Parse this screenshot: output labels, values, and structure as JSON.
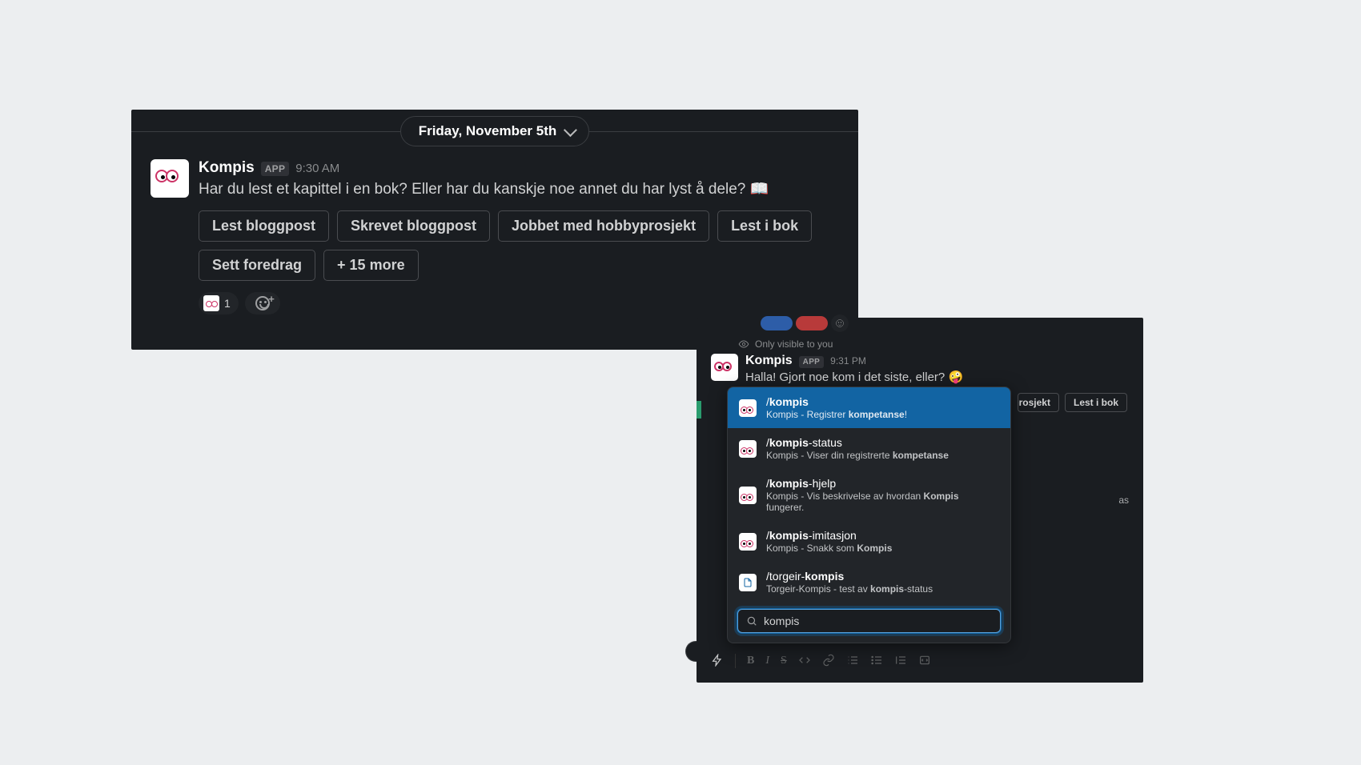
{
  "panel1": {
    "date": "Friday, November 5th",
    "sender": "Kompis",
    "app_badge": "APP",
    "time": "9:30 AM",
    "text": "Har du lest et kapittel i en bok? Eller har du kanskje noe annet du har lyst å dele? 📖",
    "buttons": [
      "Lest bloggpost",
      "Skrevet bloggpost",
      "Jobbet med hobbyprosjekt",
      "Lest i bok",
      "Sett foredrag",
      "+ 15 more"
    ],
    "reaction_count": "1"
  },
  "panel2": {
    "visibility": "Only visible to you",
    "sender": "Kompis",
    "app_badge": "APP",
    "time": "9:31 PM",
    "text": "Halla! Gjort noe kom i det siste, eller? 🤪",
    "buttons_clipped": "yprosjekt",
    "buttons_full": "Lest i bok",
    "trail": "as",
    "autocomplete": {
      "items": [
        {
          "title_pre": "/",
          "title_b": "kompis",
          "title_post": "",
          "desc_pre": "Kompis - Registrer ",
          "desc_b": "kompetanse",
          "desc_post": "!",
          "icon": "kompis"
        },
        {
          "title_pre": "/",
          "title_b": "kompis",
          "title_post": "-status",
          "desc_pre": "Kompis - Viser din registrerte ",
          "desc_b": "kompetanse",
          "desc_post": "",
          "icon": "kompis"
        },
        {
          "title_pre": "/",
          "title_b": "kompis",
          "title_post": "-hjelp",
          "desc_pre": "Kompis - Vis beskrivelse av hvordan ",
          "desc_b": "Kompis",
          "desc_post": " fungerer.",
          "icon": "kompis"
        },
        {
          "title_pre": "/",
          "title_b": "kompis",
          "title_post": "-imitasjon",
          "desc_pre": "Kompis - Snakk som ",
          "desc_b": "Kompis",
          "desc_post": "",
          "icon": "kompis"
        },
        {
          "title_pre": "/torgeir-",
          "title_b": "kompis",
          "title_post": "",
          "desc_pre": "Torgeir-Kompis - test av ",
          "desc_b": "kompis",
          "desc_post": "-status",
          "icon": "doc"
        }
      ],
      "input_value": "kompis"
    }
  }
}
